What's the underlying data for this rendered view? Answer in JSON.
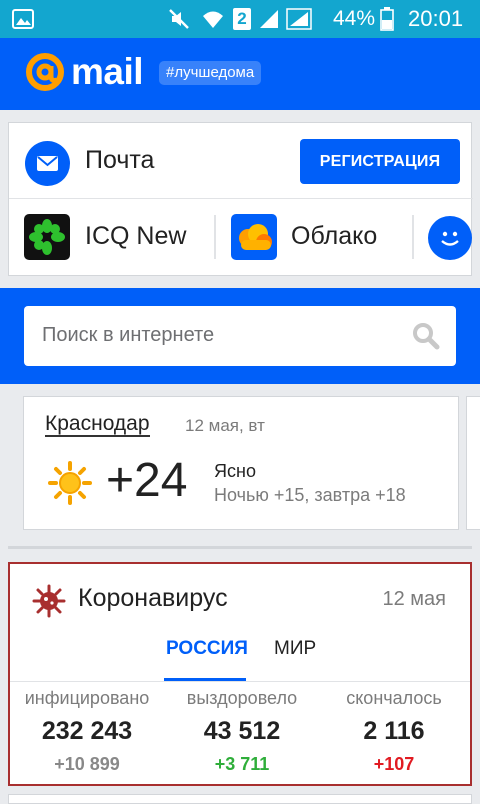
{
  "status_bar": {
    "sim": "2",
    "battery": "44%",
    "time": "20:01"
  },
  "header": {
    "brand": "mail",
    "tag": "#лучшедома"
  },
  "services": {
    "mail_label": "Почта",
    "register_label": "РЕГИСТРАЦИЯ",
    "icq_label": "ICQ New",
    "cloud_label": "Облако"
  },
  "search": {
    "placeholder": "Поиск в интернете"
  },
  "weather": {
    "city": "Краснодар",
    "date": "12 мая, вт",
    "temp": "+24",
    "condition": "Ясно",
    "forecast": "Ночью +15, завтра +18"
  },
  "covid": {
    "title": "Коронавирус",
    "date": "12 мая",
    "tabs": [
      "РОССИЯ",
      "МИР"
    ],
    "active_tab": "РОССИЯ",
    "stats": [
      {
        "label": "инфицировано",
        "value": "232 243",
        "delta": "+10 899",
        "delta_color": "#888888"
      },
      {
        "label": "выздоровело",
        "value": "43 512",
        "delta": "+3 711",
        "delta_color": "#2fae3a"
      },
      {
        "label": "скончалось",
        "value": "2 116",
        "delta": "+107",
        "delta_color": "#e11b22"
      }
    ]
  },
  "colors": {
    "accent": "#005ff9",
    "status_bar": "#13a6cf",
    "covid_border": "#a82f2f"
  }
}
